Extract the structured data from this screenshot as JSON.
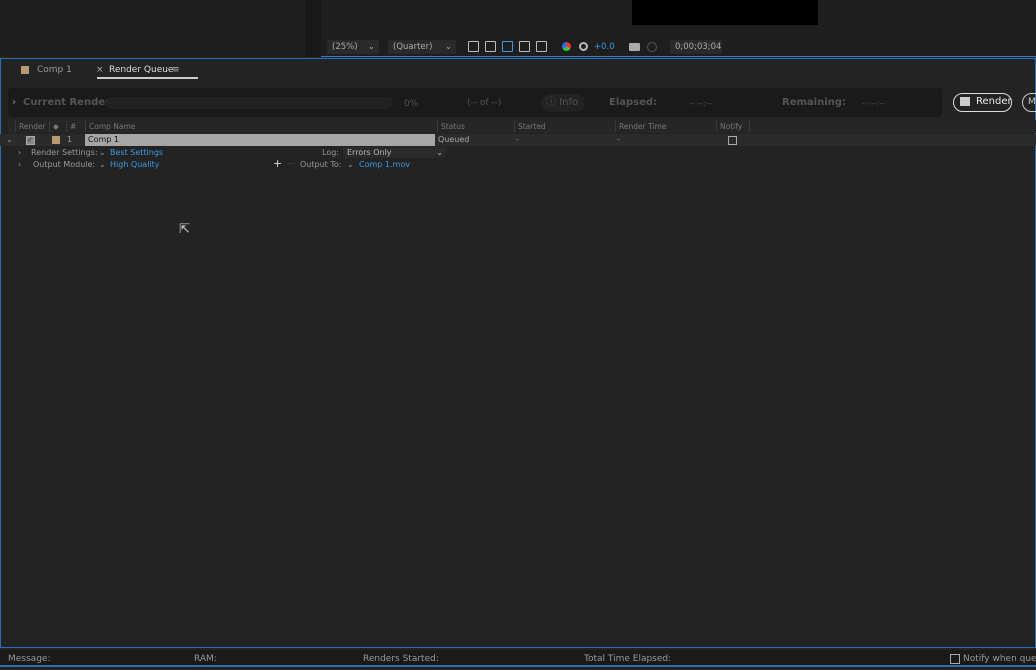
{
  "viewer": {
    "zoom": "(25%)",
    "resolution": "(Quarter)",
    "exposure": "+0.0",
    "timecode": "0;00;03;04"
  },
  "tabs": [
    {
      "label": "Comp 1"
    },
    {
      "label": "Render Queue"
    }
  ],
  "current_render": {
    "label": "Current Render",
    "percent": "0%",
    "progress": 0,
    "count": "(-- of --)",
    "info_label": "Info",
    "elapsed_label": "Elapsed:",
    "elapsed_value": "--:--:--",
    "remaining_label": "Remaining:",
    "remaining_value": "--:--:--",
    "render_button": "Render",
    "media_encoder_button": "M"
  },
  "columns": [
    "Render",
    "#",
    "Comp Name",
    "Status",
    "Started",
    "Render Time",
    "Notify"
  ],
  "queue": [
    {
      "checked": true,
      "num": "1",
      "comp": "Comp 1",
      "status": "Queued",
      "started": "-",
      "render_time": "-",
      "notify": false,
      "label_color": "#b59a72",
      "render_settings_label": "Render Settings:",
      "render_settings": "Best Settings",
      "log_label": "Log:",
      "log": "Errors Only",
      "output_module_label": "Output Module:",
      "output_module": "High Quality",
      "output_to_label": "Output To:",
      "output_to": "Comp 1.mov"
    }
  ],
  "status_bar": {
    "message": "Message:",
    "ram": "RAM:",
    "renders_started": "Renders Started:",
    "total_time": "Total Time Elapsed:",
    "notify": "Notify when queue"
  },
  "colors": {
    "accent": "#2a7ad6",
    "link": "#3a9ae6"
  }
}
